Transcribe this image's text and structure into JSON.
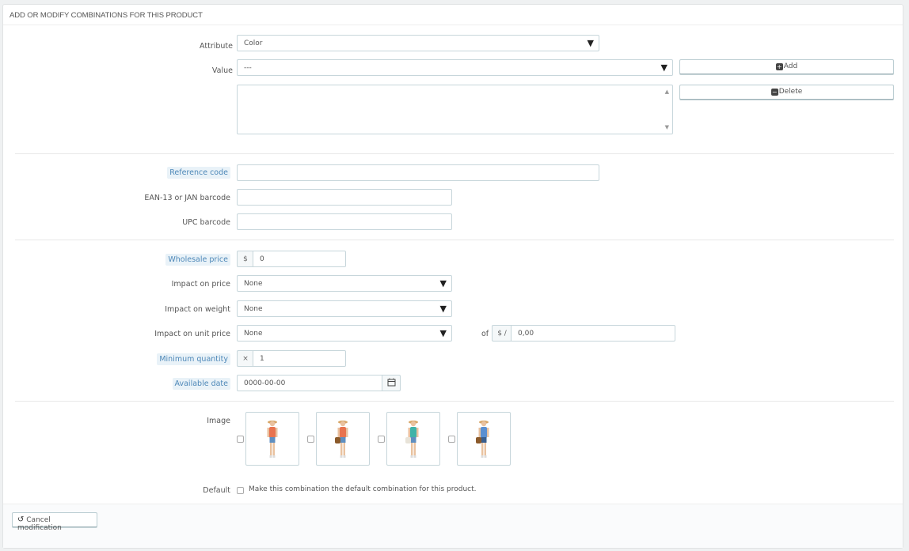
{
  "panel": {
    "title": "ADD OR MODIFY COMBINATIONS FOR THIS PRODUCT"
  },
  "attributes": {
    "attribute_label": "Attribute",
    "attribute_value": "Color",
    "value_label": "Value",
    "value_value": "---",
    "add_button": "Add",
    "delete_button": "Delete"
  },
  "codes": {
    "reference_label": "Reference code",
    "ean_label": "EAN-13 or JAN barcode",
    "upc_label": "UPC barcode"
  },
  "pricing": {
    "wholesale_label": "Wholesale price",
    "wholesale_currency": "$",
    "wholesale_value": "0",
    "impact_price_label": "Impact on price",
    "impact_price_value": "None",
    "impact_weight_label": "Impact on weight",
    "impact_weight_value": "None",
    "impact_unit_label": "Impact on unit price",
    "impact_unit_value": "None",
    "of_label": "of",
    "unit_addon": "$ /",
    "unit_value": "0,00",
    "min_qty_label": "Minimum quantity",
    "min_qty_addon": "×",
    "min_qty_value": "1",
    "available_label": "Available date",
    "available_value": "0000-00-00"
  },
  "images": {
    "label": "Image",
    "thumbs": [
      {
        "shirt": "#e8734f",
        "shorts": "#5f8fc0",
        "bag": null
      },
      {
        "shirt": "#e8734f",
        "shorts": "#5f8fc0",
        "bag": "#8b5a2b"
      },
      {
        "shirt": "#3fb3a8",
        "shorts": "#5f8fc0",
        "bag": "#e8e3d8"
      },
      {
        "shirt": "#5b8fd0",
        "shorts": "#3a5f8e",
        "bag": "#8b5a2b"
      }
    ]
  },
  "default": {
    "label": "Default",
    "text": "Make this combination the default combination for this product."
  },
  "footer": {
    "cancel_button": "Cancel modification"
  }
}
